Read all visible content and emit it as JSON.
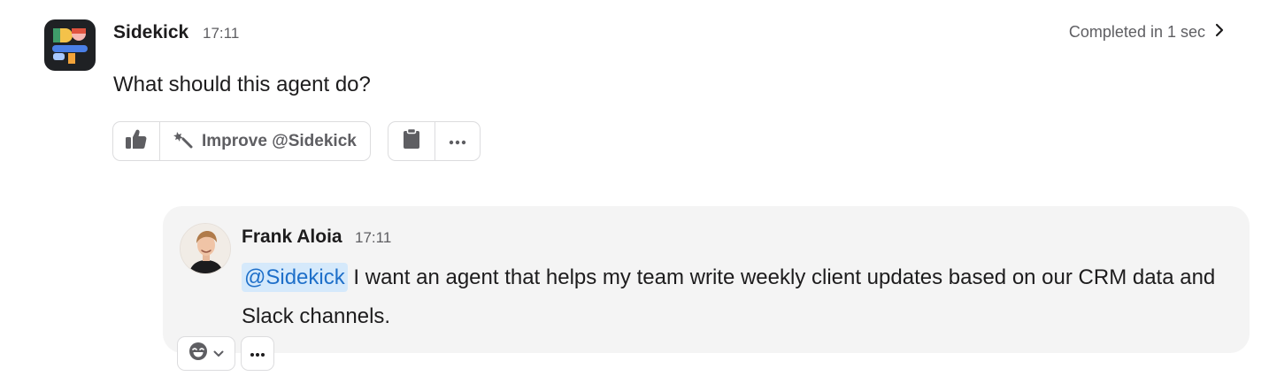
{
  "agent_message": {
    "sender": "Sidekick",
    "time": "17:11",
    "status": "Completed in 1 sec",
    "text": "What should this agent do?",
    "actions": {
      "improve_label": "Improve @Sidekick"
    }
  },
  "user_message": {
    "sender": "Frank Aloia",
    "time": "17:11",
    "mention": "@Sidekick",
    "text": " I want an agent that helps my team write weekly client updates based on our CRM data and Slack channels."
  },
  "icons": [
    "sidekick-logo",
    "chevron-right-icon",
    "thumbs-up-icon",
    "magic-wand-icon",
    "clipboard-icon",
    "more-icon",
    "emoji-icon",
    "chevron-down-icon"
  ],
  "colors": {
    "mention_bg": "#d5e9fb",
    "mention_text": "#1e6fc9",
    "card_bg": "#f4f4f4",
    "muted_text": "#5e5e62"
  }
}
